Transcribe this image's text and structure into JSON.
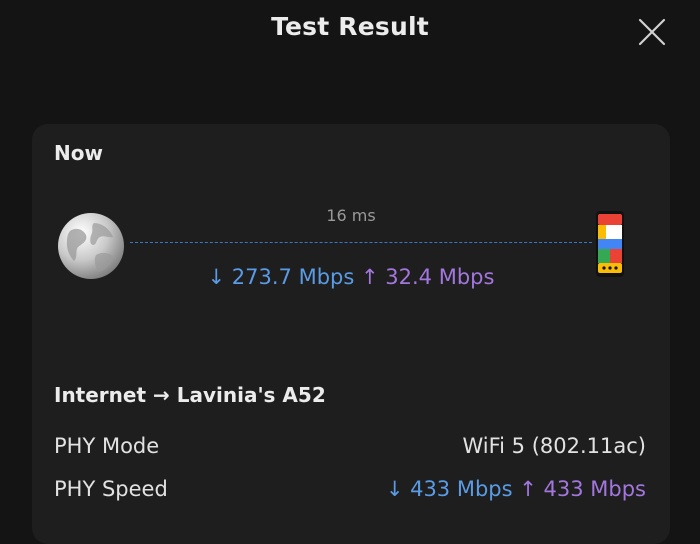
{
  "header": {
    "title": "Test Result",
    "close_icon": "close-icon"
  },
  "card": {
    "heading": "Now",
    "latency": "16 ms",
    "download": "↓ 273.7 Mbps",
    "upload": "↑ 32.4 Mbps",
    "source_icon": "earth-globe-icon",
    "target_icon": "phone-device-icon"
  },
  "details": {
    "section_title": "Internet → Lavinia's A52",
    "rows": [
      {
        "label": "PHY Mode",
        "value": "WiFi 5 (802.11ac)"
      },
      {
        "label": "PHY Speed",
        "download": "↓ 433 Mbps",
        "upload": "↑ 433 Mbps"
      }
    ]
  },
  "colors": {
    "background": "#141414",
    "card": "#1e1e1e",
    "download": "#5a9be6",
    "upload": "#a276dd",
    "link_line": "#3b77c9"
  }
}
